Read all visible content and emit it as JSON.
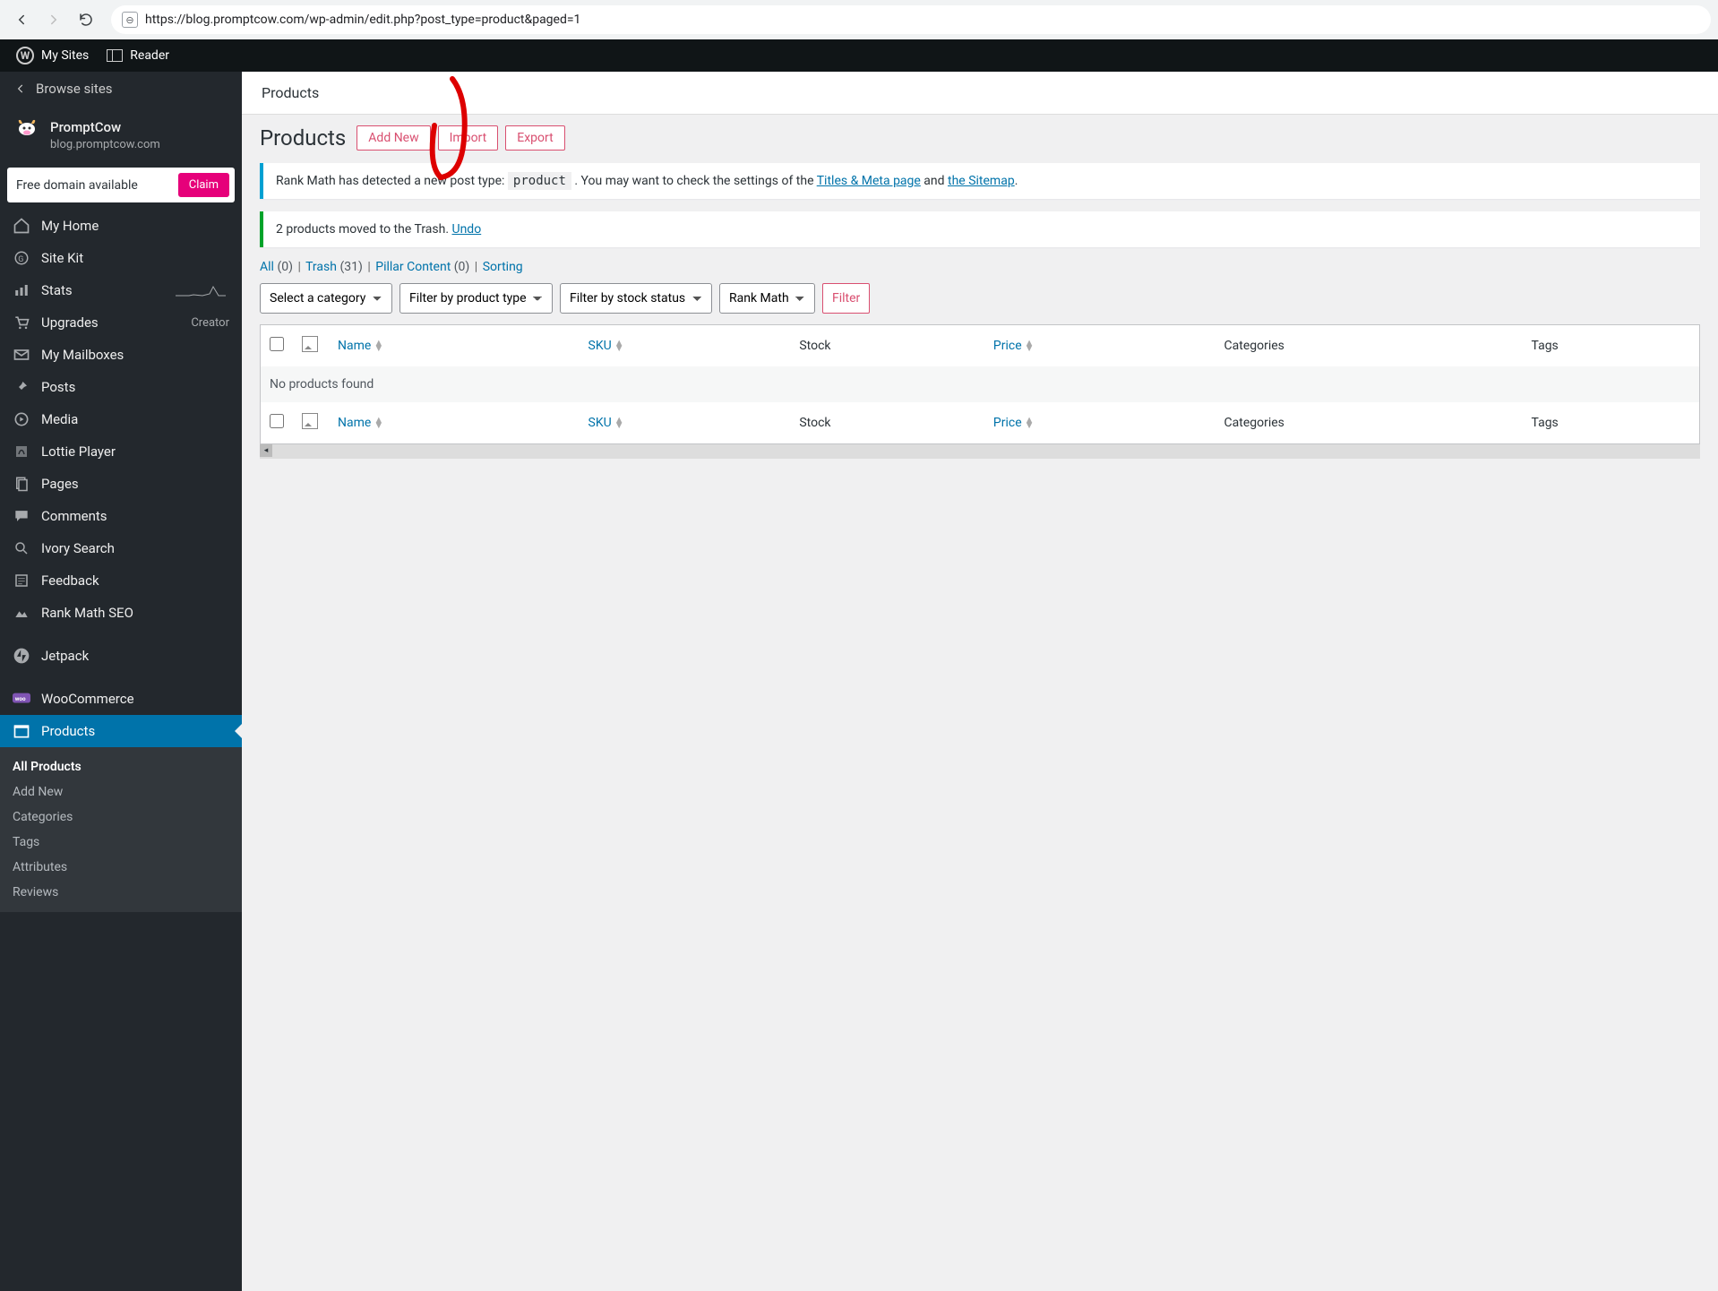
{
  "browser": {
    "url": "https://blog.promptcow.com/wp-admin/edit.php?post_type=product&paged=1"
  },
  "topbar": {
    "mysites": "My Sites",
    "reader": "Reader"
  },
  "sidebar": {
    "browse": "Browse sites",
    "site_name": "PromptCow",
    "site_domain": "blog.promptcow.com",
    "claim_text": "Free domain available",
    "claim_btn": "Claim",
    "items": [
      {
        "label": "My Home"
      },
      {
        "label": "Site Kit"
      },
      {
        "label": "Stats"
      },
      {
        "label": "Upgrades",
        "meta": "Creator"
      },
      {
        "label": "My Mailboxes"
      },
      {
        "label": "Posts"
      },
      {
        "label": "Media"
      },
      {
        "label": "Lottie Player"
      },
      {
        "label": "Pages"
      },
      {
        "label": "Comments"
      },
      {
        "label": "Ivory Search"
      },
      {
        "label": "Feedback"
      },
      {
        "label": "Rank Math SEO"
      },
      {
        "label": "Jetpack"
      },
      {
        "label": "WooCommerce"
      },
      {
        "label": "Products"
      }
    ],
    "submenu": [
      "All Products",
      "Add New",
      "Categories",
      "Tags",
      "Attributes",
      "Reviews"
    ]
  },
  "main": {
    "header": "Products",
    "page_title": "Products",
    "buttons": {
      "add": "Add New",
      "import": "Import",
      "export": "Export"
    },
    "notice1_a": "Rank Math has detected a new post type: ",
    "notice1_code": "product",
    "notice1_b": " . You may want to check the settings of the ",
    "notice1_link1": "Titles & Meta page",
    "notice1_c": " and ",
    "notice1_link2": "the Sitemap",
    "notice1_d": ".",
    "notice2_a": "2 products moved to the Trash. ",
    "notice2_link": "Undo",
    "subsubsub": {
      "all": "All",
      "all_count": "(0)",
      "trash": "Trash",
      "trash_count": "(31)",
      "pillar": "Pillar Content",
      "pillar_count": "(0)",
      "sorting": "Sorting"
    },
    "filters": {
      "category": "Select a category",
      "type": "Filter by product type",
      "stock": "Filter by stock status",
      "rank": "Rank Math",
      "filter_btn": "Filter"
    },
    "columns": {
      "name": "Name",
      "sku": "SKU",
      "stock": "Stock",
      "price": "Price",
      "categories": "Categories",
      "tags": "Tags"
    },
    "no_results": "No products found"
  }
}
